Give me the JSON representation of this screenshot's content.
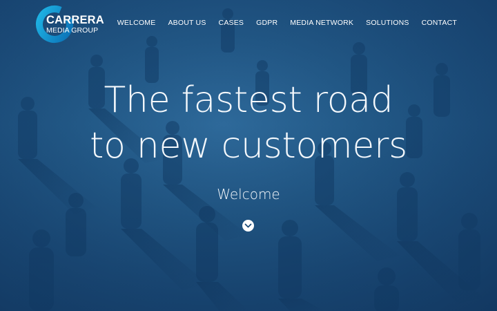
{
  "brand": {
    "name": "CARRERA",
    "sub": "MEDIA GROUP",
    "ring_color_outer": "#1fb6e6",
    "ring_color_inner": "#0a6fb5"
  },
  "nav": {
    "items": [
      {
        "label": "WELCOME"
      },
      {
        "label": "ABOUT US"
      },
      {
        "label": "CASES"
      },
      {
        "label": "GDPR"
      },
      {
        "label": "MEDIA NETWORK"
      },
      {
        "label": "SOLUTIONS"
      },
      {
        "label": "CONTACT"
      }
    ]
  },
  "hero": {
    "headline_line1": "The fastest road",
    "headline_line2": "to new customers",
    "welcome": "Welcome",
    "scroll_icon": "chevron-down-icon",
    "overlay_color": "#1b4b78"
  }
}
